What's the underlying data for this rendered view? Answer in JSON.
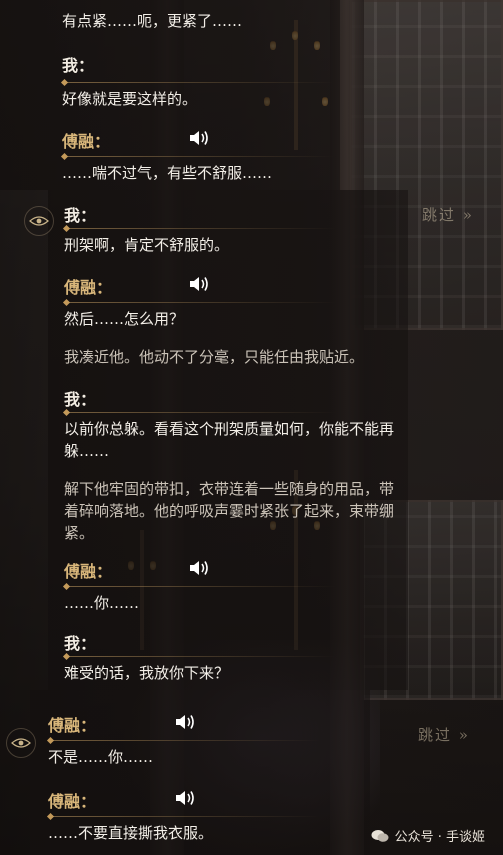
{
  "skip_label": "跳过",
  "watermark": "公众号 · 手谈姬",
  "lines": [
    {
      "kind": "text",
      "text": "有点紧……呃，更紧了……"
    },
    {
      "speaker": "我："
    },
    {
      "kind": "text",
      "text": "好像就是要这样的。"
    },
    {
      "speaker": "傅融："
    },
    {
      "kind": "text",
      "text": "……喘不过气，有些不舒服……"
    },
    {
      "speaker": "我："
    },
    {
      "kind": "text",
      "text": "刑架啊，肯定不舒服的。"
    },
    {
      "speaker": "傅融："
    },
    {
      "kind": "text",
      "text": "然后……怎么用？"
    },
    {
      "kind": "narration",
      "text": "我凑近他。他动不了分毫，只能任由我贴近。"
    },
    {
      "speaker": "我："
    },
    {
      "kind": "text",
      "text": "以前你总躲。看看这个刑架质量如何，你能不能再"
    },
    {
      "kind": "text",
      "text": "躲……"
    },
    {
      "kind": "narration",
      "text": "解下他牢固的带扣，衣带连着一些随身的用品，带"
    },
    {
      "kind": "narration",
      "text": "着碎响落地。他的呼吸声霎时紧张了起来，束带绷"
    },
    {
      "kind": "narration",
      "text": "紧。"
    },
    {
      "speaker": "傅融："
    },
    {
      "kind": "text",
      "text": "……你……"
    },
    {
      "speaker": "我："
    },
    {
      "kind": "text",
      "text": "难受的话，我放你下来？"
    },
    {
      "speaker": "傅融："
    },
    {
      "kind": "text",
      "text": "不是……你……"
    },
    {
      "speaker": "傅融："
    },
    {
      "kind": "text",
      "text": "……不要直接撕我衣服。"
    }
  ]
}
